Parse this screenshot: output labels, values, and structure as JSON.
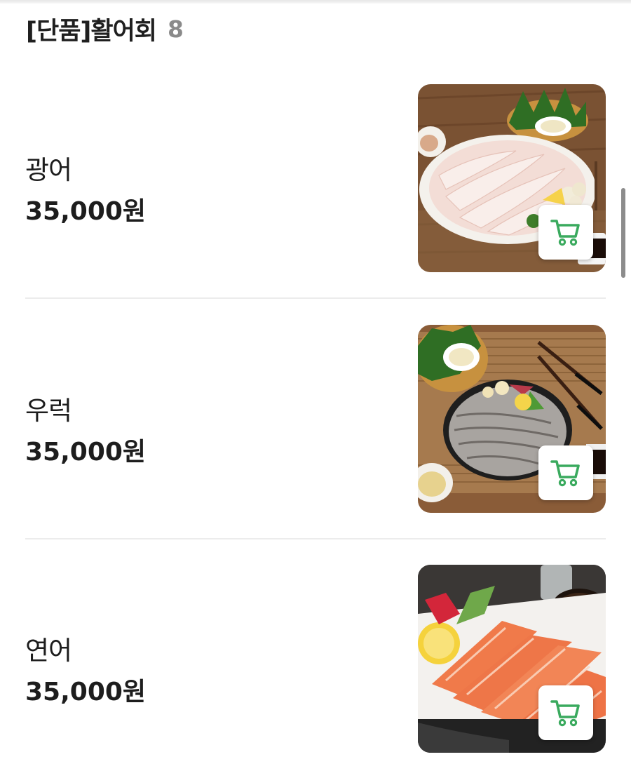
{
  "section": {
    "title": "[단품]활어회",
    "count": "8"
  },
  "items": [
    {
      "name": "광어",
      "price": "35,000원"
    },
    {
      "name": "우럭",
      "price": "35,000원"
    },
    {
      "name": "연어",
      "price": "35,000원"
    }
  ],
  "icons": {
    "cart": "shopping-cart-icon"
  },
  "colors": {
    "accent_green": "#3aaa5e",
    "text": "#1d1d1d",
    "count_gray": "#8a8a8a"
  }
}
